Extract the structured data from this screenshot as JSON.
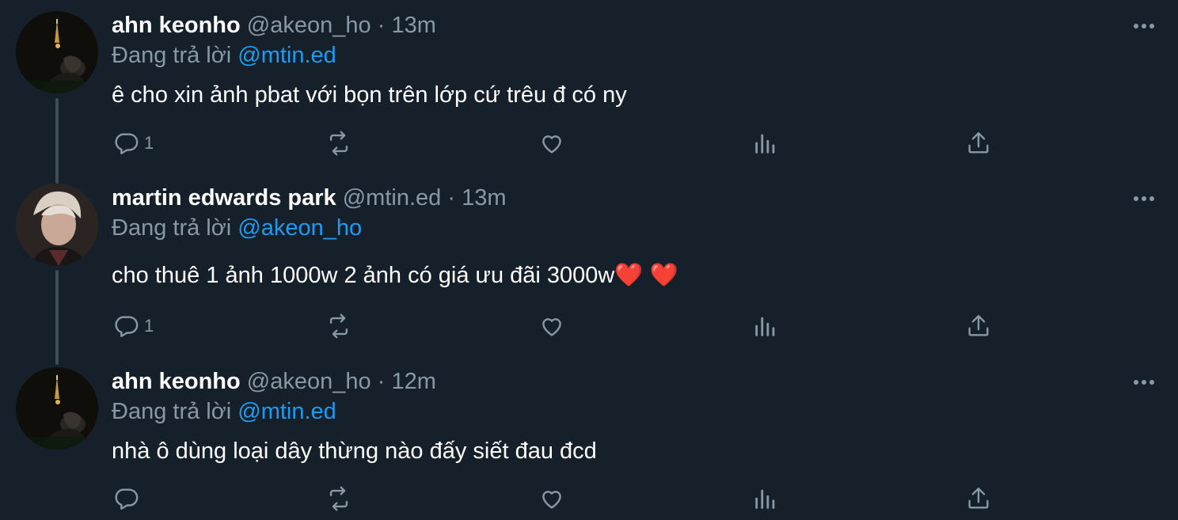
{
  "reply_prefix": "Đang trả lời",
  "tweets": [
    {
      "display_name": "ahn keonho",
      "handle": "@akeon_ho",
      "separator": "·",
      "time": "13m",
      "reply_to": "@mtin.ed",
      "text": "ê cho xin ảnh pbat với bọn trên lớp cứ trêu đ có ny",
      "text_hearts": "",
      "reply_count": "1",
      "avatar_icon": "night-photo-avatar"
    },
    {
      "display_name": "martin edwards park",
      "handle": "@mtin.ed",
      "separator": "·",
      "time": "13m",
      "reply_to": "@akeon_ho",
      "text": "cho thuê 1 ảnh 1000w 2 ảnh có giá ưu đãi 3000w",
      "text_hearts": "❤️ ❤️",
      "reply_count": "1",
      "avatar_icon": "portrait-avatar"
    },
    {
      "display_name": "ahn keonho",
      "handle": "@akeon_ho",
      "separator": "·",
      "time": "12m",
      "reply_to": "@mtin.ed",
      "text": "nhà ô dùng loại dây thừng nào đấy siết đau đcd",
      "text_hearts": "",
      "reply_count": "",
      "avatar_icon": "night-photo-avatar"
    }
  ],
  "colors": {
    "background": "#15202b",
    "secondary_text": "#8899a6",
    "mention": "#1d9bf0",
    "thread_line": "#3d4b57"
  }
}
